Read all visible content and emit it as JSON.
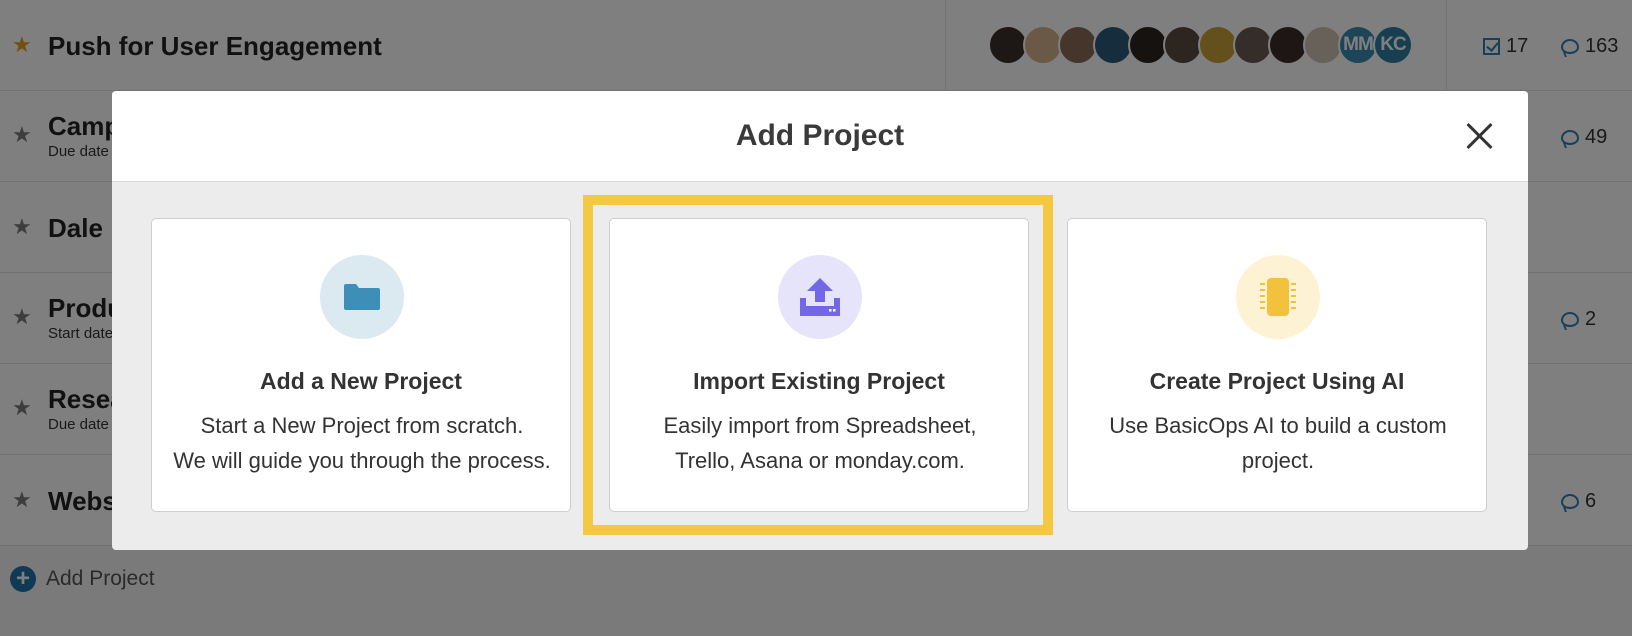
{
  "projects": [
    {
      "name": "Push for User Engagement",
      "sub": "",
      "starred": true,
      "tasks": "17",
      "comments": "163"
    },
    {
      "name": "Camp",
      "sub": "Due date",
      "starred": false,
      "comments": "49"
    },
    {
      "name": "Dale",
      "sub": "",
      "starred": false,
      "comments": ""
    },
    {
      "name": "Produ",
      "sub": "Start date",
      "starred": false,
      "comments": "2"
    },
    {
      "name": "Resea",
      "sub": "Due date",
      "starred": false,
      "comments": ""
    },
    {
      "name": "Webs",
      "sub": "",
      "starred": false,
      "comments": "6"
    }
  ],
  "avatars": [
    {
      "initials": "",
      "color": "#3a2f2a"
    },
    {
      "initials": "",
      "color": "#d7b38f"
    },
    {
      "initials": "",
      "color": "#8a6a56"
    },
    {
      "initials": "",
      "color": "#2c5a7a"
    },
    {
      "initials": "",
      "color": "#2b2420"
    },
    {
      "initials": "",
      "color": "#5b4a40"
    },
    {
      "initials": "",
      "color": "#c9a13b"
    },
    {
      "initials": "",
      "color": "#6a5a52"
    },
    {
      "initials": "",
      "color": "#3b2d29"
    },
    {
      "initials": "",
      "color": "#cfc2b5"
    },
    {
      "initials": "MM",
      "color": "#3b8bb0"
    },
    {
      "initials": "KC",
      "color": "#2f7fa3"
    }
  ],
  "footer": {
    "add_project_label": "Add Project"
  },
  "modal": {
    "title": "Add Project",
    "cards": [
      {
        "title": "Add a New Project",
        "line1": "Start a New Project from scratch.",
        "line2": "We will guide you through the process.",
        "icon": "folder-icon",
        "circle_color": "#dbe9f0",
        "icon_color": "#3d8fb8"
      },
      {
        "title": "Import Existing Project",
        "line1": "Easily import from Spreadsheet,",
        "line2": "Trello, Asana or monday.com.",
        "icon": "upload-icon",
        "circle_color": "#e6e4fb",
        "icon_color": "#7367e8"
      },
      {
        "title": "Create Project Using AI",
        "line1": "Use BasicOps AI to build a custom",
        "line2": "project.",
        "icon": "chip-icon",
        "circle_color": "#fdf2d4",
        "icon_color": "#f3c23c"
      }
    ]
  },
  "colors": {
    "highlight": "#f5c842",
    "accent": "#1f73a8"
  }
}
